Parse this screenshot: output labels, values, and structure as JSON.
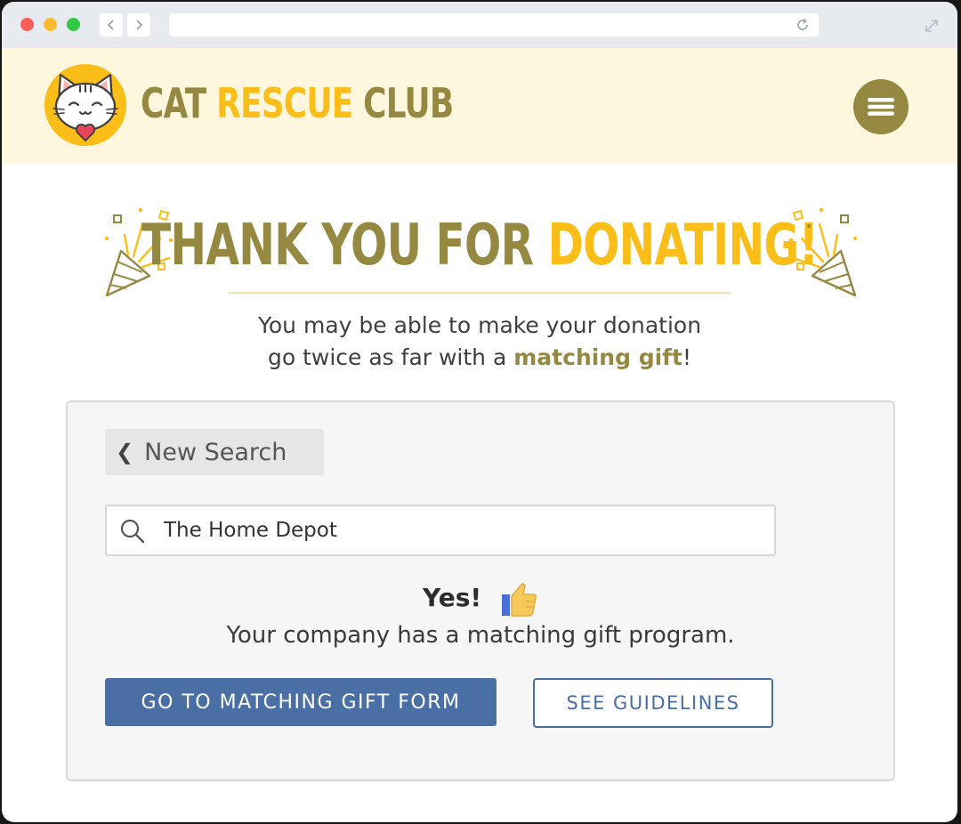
{
  "browser": {
    "back_icon": "chevron-left-icon",
    "forward_icon": "chevron-right-icon",
    "reload_icon": "reload-icon",
    "expand_icon": "expand-icon"
  },
  "header": {
    "brand": {
      "word1": "CAT",
      "word2": "RESCUE",
      "word3": "CLUB"
    },
    "logo_icon": "cat-logo-icon",
    "menu_icon": "hamburger-menu-icon",
    "colors": {
      "background": "#fef6dd",
      "olive": "#958841",
      "gold": "#fbbd17"
    }
  },
  "hero": {
    "title_part1": "THANK YOU FOR ",
    "title_part2": "DONATING!",
    "subtitle_line1": "You may be able to make your donation",
    "subtitle_line2_pre": "go twice as far with a ",
    "subtitle_highlight": "matching gift",
    "subtitle_line2_post": "!",
    "decoration_icon": "party-popper-icon"
  },
  "card": {
    "new_search_label": "New Search",
    "search": {
      "value": "The Home Depot",
      "icon": "search-icon"
    },
    "result": {
      "headline": "Yes!",
      "icon": "thumbs-up-icon",
      "message": "Your company has a matching gift program."
    },
    "primary_button": "GO TO MATCHING GIFT FORM",
    "secondary_button": "SEE GUIDELINES",
    "colors": {
      "button_blue": "#4a6fa5"
    }
  }
}
